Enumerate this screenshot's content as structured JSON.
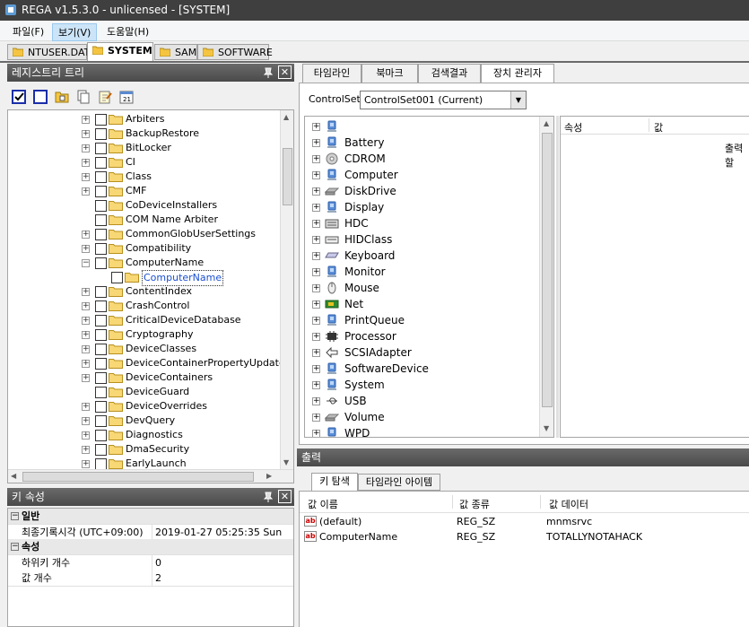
{
  "window": {
    "title": "REGA v1.5.3.0 - unlicensed - [SYSTEM]"
  },
  "menu": [
    {
      "label": "파일(F)"
    },
    {
      "label": "보기(V)"
    },
    {
      "label": "도움말(H)"
    }
  ],
  "doc_tabs": [
    {
      "label": "NTUSER.DAT"
    },
    {
      "label": "SYSTEM"
    },
    {
      "label": "SAM"
    },
    {
      "label": "SOFTWARE"
    }
  ],
  "tree_panel": {
    "title": "레지스트리 트리",
    "close_glyph": "✕",
    "items": [
      {
        "label": "Arbiters",
        "expander": "+"
      },
      {
        "label": "BackupRestore",
        "expander": "+"
      },
      {
        "label": "BitLocker",
        "expander": "+"
      },
      {
        "label": "CI",
        "expander": "+"
      },
      {
        "label": "Class",
        "expander": "+"
      },
      {
        "label": "CMF",
        "expander": "+"
      },
      {
        "label": "CoDeviceInstallers",
        "expander": ""
      },
      {
        "label": "COM Name Arbiter",
        "expander": ""
      },
      {
        "label": "CommonGlobUserSettings",
        "expander": "+"
      },
      {
        "label": "Compatibility",
        "expander": "+"
      },
      {
        "label": "ComputerName",
        "expander": "−"
      },
      {
        "label": "ComputerName",
        "expander": "",
        "child": true,
        "selected": true
      },
      {
        "label": "ContentIndex",
        "expander": "+"
      },
      {
        "label": "CrashControl",
        "expander": "+"
      },
      {
        "label": "CriticalDeviceDatabase",
        "expander": "+"
      },
      {
        "label": "Cryptography",
        "expander": "+"
      },
      {
        "label": "DeviceClasses",
        "expander": "+"
      },
      {
        "label": "DeviceContainerPropertyUpdateEv",
        "expander": "+"
      },
      {
        "label": "DeviceContainers",
        "expander": "+"
      },
      {
        "label": "DeviceGuard",
        "expander": ""
      },
      {
        "label": "DeviceOverrides",
        "expander": "+"
      },
      {
        "label": "DevQuery",
        "expander": "+"
      },
      {
        "label": "Diagnostics",
        "expander": "+"
      },
      {
        "label": "DmaSecurity",
        "expander": "+"
      },
      {
        "label": "EarlyLaunch",
        "expander": "+"
      }
    ]
  },
  "key_props": {
    "title": "키 속성",
    "close_glyph": "✕",
    "cat_general": "일반",
    "last_write_label": "최종기록시각 (UTC+09:00)",
    "last_write_value": "2019-01-27  05:25:35  Sun",
    "cat_props": "속성",
    "subkey_count_label": "하위키 개수",
    "subkey_count_value": "0",
    "value_count_label": "값 개수",
    "value_count_value": "2"
  },
  "right_tabs": [
    {
      "label": "타임라인"
    },
    {
      "label": "북마크"
    },
    {
      "label": "검색결과"
    },
    {
      "label": "장치 관리자"
    }
  ],
  "controlset": {
    "label": "ControlSet",
    "value": "ControlSet001 (Current)"
  },
  "devices": [
    {
      "label": "",
      "icon": "computer-icon"
    },
    {
      "label": "Battery",
      "icon": "battery-icon"
    },
    {
      "label": "CDROM",
      "icon": "cdrom-icon"
    },
    {
      "label": "Computer",
      "icon": "computer-icon"
    },
    {
      "label": "DiskDrive",
      "icon": "disk-icon"
    },
    {
      "label": "Display",
      "icon": "display-icon"
    },
    {
      "label": "HDC",
      "icon": "hdc-icon"
    },
    {
      "label": "HIDClass",
      "icon": "hid-icon"
    },
    {
      "label": "Keyboard",
      "icon": "keyboard-icon"
    },
    {
      "label": "Monitor",
      "icon": "monitor-icon"
    },
    {
      "label": "Mouse",
      "icon": "mouse-icon"
    },
    {
      "label": "Net",
      "icon": "network-card-icon"
    },
    {
      "label": "PrintQueue",
      "icon": "printer-icon"
    },
    {
      "label": "Processor",
      "icon": "processor-icon"
    },
    {
      "label": "SCSIAdapter",
      "icon": "scsi-icon"
    },
    {
      "label": "SoftwareDevice",
      "icon": "software-device-icon"
    },
    {
      "label": "System",
      "icon": "system-icon"
    },
    {
      "label": "USB",
      "icon": "usb-icon"
    },
    {
      "label": "Volume",
      "icon": "volume-icon"
    },
    {
      "label": "WPD",
      "icon": "wpd-icon"
    }
  ],
  "device_props": {
    "col_attr": "속성",
    "col_value": "값",
    "output_text": "출력할"
  },
  "output_panel": {
    "title": "출력",
    "tabs": [
      {
        "label": "키 탐색"
      },
      {
        "label": "타임라인 아이템"
      }
    ],
    "columns": {
      "name": "값 이름",
      "type": "값 종류",
      "data": "값 데이터"
    },
    "rows": [
      {
        "name": "(default)",
        "type": "REG_SZ",
        "data": "mnmsrvc",
        "icon": "ab"
      },
      {
        "name": "ComputerName",
        "type": "REG_SZ",
        "data": "TOTALLYNOTAHACK",
        "icon": "ab"
      }
    ]
  }
}
